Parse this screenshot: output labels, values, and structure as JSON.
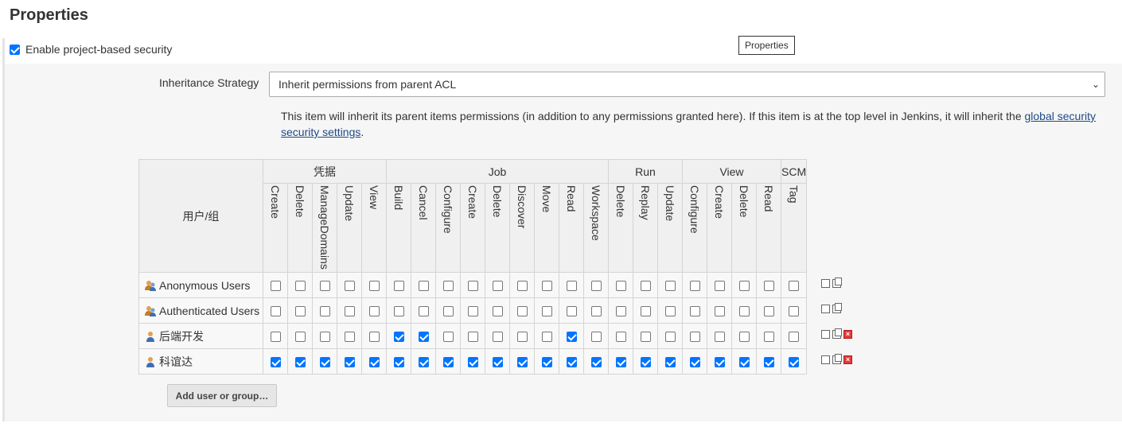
{
  "page_title": "Properties",
  "tooltip": "Properties",
  "enable_label": "Enable project-based security",
  "enable_checked": true,
  "inheritance": {
    "label": "Inheritance Strategy",
    "selected": "Inherit permissions from parent ACL"
  },
  "help": {
    "text": "This item will inherit its parent items permissions (in addition to any permissions granted here). If this item is at the top level in Jenkins, it will inherit the ",
    "link_text": "global security security settings",
    "suffix": "."
  },
  "matrix": {
    "user_header": "用户/组",
    "groups": [
      {
        "name": "凭据",
        "span": 5
      },
      {
        "name": "Job",
        "span": 9
      },
      {
        "name": "Run",
        "span": 3
      },
      {
        "name": "View",
        "span": 4
      },
      {
        "name": "SCM",
        "span": 1
      }
    ],
    "permissions": [
      "Create",
      "Delete",
      "ManageDomains",
      "Update",
      "View",
      "Build",
      "Cancel",
      "Configure",
      "Create",
      "Delete",
      "Discover",
      "Move",
      "Read",
      "Workspace",
      "Delete",
      "Replay",
      "Update",
      "Configure",
      "Create",
      "Delete",
      "Read",
      "Tag"
    ],
    "rows": [
      {
        "name": "Anonymous Users",
        "icon": "group-icon",
        "removable": false,
        "checks": [
          0,
          0,
          0,
          0,
          0,
          0,
          0,
          0,
          0,
          0,
          0,
          0,
          0,
          0,
          0,
          0,
          0,
          0,
          0,
          0,
          0,
          0
        ]
      },
      {
        "name": "Authenticated Users",
        "icon": "group-icon",
        "removable": false,
        "checks": [
          0,
          0,
          0,
          0,
          0,
          0,
          0,
          0,
          0,
          0,
          0,
          0,
          0,
          0,
          0,
          0,
          0,
          0,
          0,
          0,
          0,
          0
        ]
      },
      {
        "name": "后端开发",
        "icon": "user-icon",
        "removable": true,
        "checks": [
          0,
          0,
          0,
          0,
          0,
          1,
          1,
          0,
          0,
          0,
          0,
          0,
          1,
          0,
          0,
          0,
          0,
          0,
          0,
          0,
          0,
          0
        ]
      },
      {
        "name": "科谊达",
        "icon": "user-icon",
        "removable": true,
        "checks": [
          1,
          1,
          1,
          1,
          1,
          1,
          1,
          1,
          1,
          1,
          1,
          1,
          1,
          1,
          1,
          1,
          1,
          1,
          1,
          1,
          1,
          1
        ]
      }
    ]
  },
  "add_button": "Add user or group…"
}
